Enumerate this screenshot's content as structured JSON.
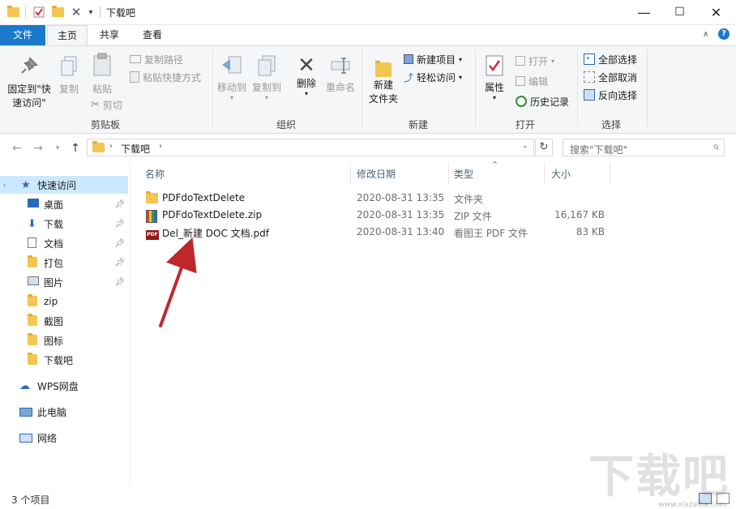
{
  "window": {
    "title": "下载吧",
    "controls": {
      "minimize": "—",
      "maximize": "☐",
      "close": "✕"
    },
    "qat_dropdown": "▾"
  },
  "tabs": [
    {
      "label": "文件"
    },
    {
      "label": "主页"
    },
    {
      "label": "共享"
    },
    {
      "label": "查看"
    }
  ],
  "ribbon": {
    "groups": {
      "clipboard": {
        "label": "剪贴板",
        "pin": "固定到\"快\n速访问\"",
        "copy": "复制",
        "paste": "粘贴",
        "copy_path": "复制路径",
        "paste_shortcut": "粘贴快捷方式",
        "cut": "剪切"
      },
      "organize": {
        "label": "组织",
        "move_to": "移动到",
        "copy_to": "复制到",
        "delete": "删除",
        "rename": "重命名"
      },
      "new": {
        "label": "新建",
        "new_folder": "新建\n文件夹",
        "new_item": "新建项目",
        "easy_access": "轻松访问"
      },
      "open": {
        "label": "打开",
        "properties": "属性",
        "open": "打开",
        "edit": "编辑",
        "history": "历史记录"
      },
      "select": {
        "label": "选择",
        "select_all": "全部选择",
        "select_none": "全部取消",
        "invert": "反向选择"
      }
    }
  },
  "address": {
    "path": "下载吧",
    "search_placeholder": "搜索\"下载吧\""
  },
  "nav": {
    "quick_access": "快速访问",
    "items": [
      {
        "label": "桌面",
        "icon": "desktop-icon",
        "pinned": true
      },
      {
        "label": "下载",
        "icon": "download-icon",
        "pinned": true
      },
      {
        "label": "文档",
        "icon": "document-icon",
        "pinned": true
      },
      {
        "label": "打包",
        "icon": "folder-icon",
        "pinned": true
      },
      {
        "label": "图片",
        "icon": "pictures-icon",
        "pinned": true
      },
      {
        "label": "zip",
        "icon": "folder-icon",
        "pinned": false
      },
      {
        "label": "截图",
        "icon": "folder-icon",
        "pinned": false
      },
      {
        "label": "图标",
        "icon": "folder-icon",
        "pinned": false
      },
      {
        "label": "下载吧",
        "icon": "folder-icon",
        "pinned": false
      }
    ],
    "wps": "WPS网盘",
    "this_pc": "此电脑",
    "network": "网络"
  },
  "columns": {
    "name": "名称",
    "modified": "修改日期",
    "type": "类型",
    "size": "大小"
  },
  "files": [
    {
      "name": "PDFdoTextDelete",
      "modified": "2020-08-31 13:35",
      "type": "文件夹",
      "size": "",
      "icon": "folder-icon"
    },
    {
      "name": "PDFdoTextDelete.zip",
      "modified": "2020-08-31 13:35",
      "type": "ZIP 文件",
      "size": "16,167 KB",
      "icon": "zip-icon"
    },
    {
      "name": "Del_新建 DOC 文档.pdf",
      "modified": "2020-08-31 13:40",
      "type": "看图王 PDF 文件",
      "size": "83 KB",
      "icon": "pdf-icon"
    }
  ],
  "status": {
    "count": "3 个项目"
  },
  "watermark": {
    "text": "下载吧",
    "url": "www.xiazaiba.com"
  },
  "colors": {
    "accent": "#1979ca",
    "selection": "#cce8ff",
    "arrow": "#c0272d"
  }
}
